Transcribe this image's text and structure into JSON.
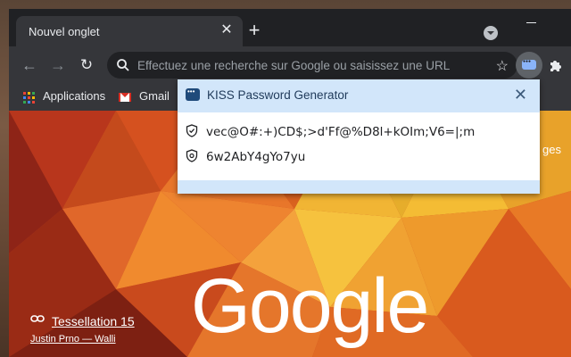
{
  "tab": {
    "title": "Nouvel onglet",
    "close_icon": "close-icon",
    "new_tab_icon": "plus-icon"
  },
  "toolbar": {
    "back_icon": "arrow-left-icon",
    "forward_icon": "arrow-right-icon",
    "reload_icon": "reload-icon",
    "omnibox_placeholder": "Effectuez une recherche sur Google ou saisissez une URL",
    "bookmark_icon": "star-icon",
    "extensions_icon": "puzzle-icon"
  },
  "bookmarks": [
    {
      "label": "Applications",
      "icon": "apps-grid-icon"
    },
    {
      "label": "Gmail",
      "icon": "gmail-icon"
    }
  ],
  "ntp": {
    "logo_text": "Google",
    "right_label": "ges",
    "credit_title": "Tessellation 15",
    "credit_author": "Justin Prno — Walli"
  },
  "popup": {
    "title": "KISS Password Generator",
    "passwords": [
      "vec@O#:+)CD$;>d'Ff@%D8l+kOIm;V6=|;m",
      "6w2AbY4gYo7yu"
    ]
  },
  "colors": {
    "chrome_dark": "#202124",
    "toolbar": "#35363a",
    "popup_header": "#d2e6fa",
    "ntp_base": "#c2441e"
  }
}
